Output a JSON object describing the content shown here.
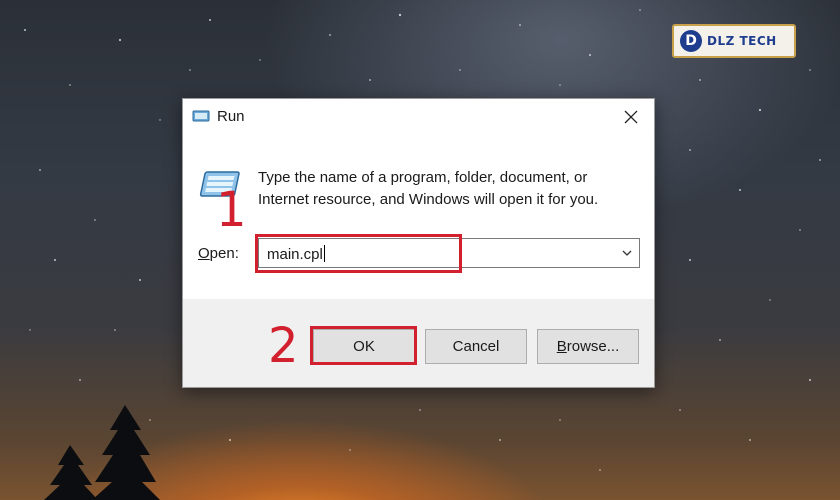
{
  "watermark": {
    "logo_letter": "D",
    "brand": "DLZ TECH"
  },
  "dialog": {
    "title": "Run",
    "description": "Type the name of a program, folder, document, or Internet resource, and Windows will open it for you.",
    "open_label_prefix": "O",
    "open_label_rest": "pen:",
    "input_value": "main.cpl",
    "buttons": {
      "ok": "OK",
      "cancel": "Cancel",
      "browse_prefix": "B",
      "browse_rest": "rowse..."
    }
  },
  "annotations": {
    "step1": "1",
    "step2": "2"
  },
  "colors": {
    "highlight": "#d3202f",
    "footer_bg": "#f0f0f0",
    "button_bg": "#e1e1e1"
  },
  "icons": [
    "run-app-icon",
    "close-icon",
    "chevron-down-icon",
    "tree-silhouette"
  ]
}
